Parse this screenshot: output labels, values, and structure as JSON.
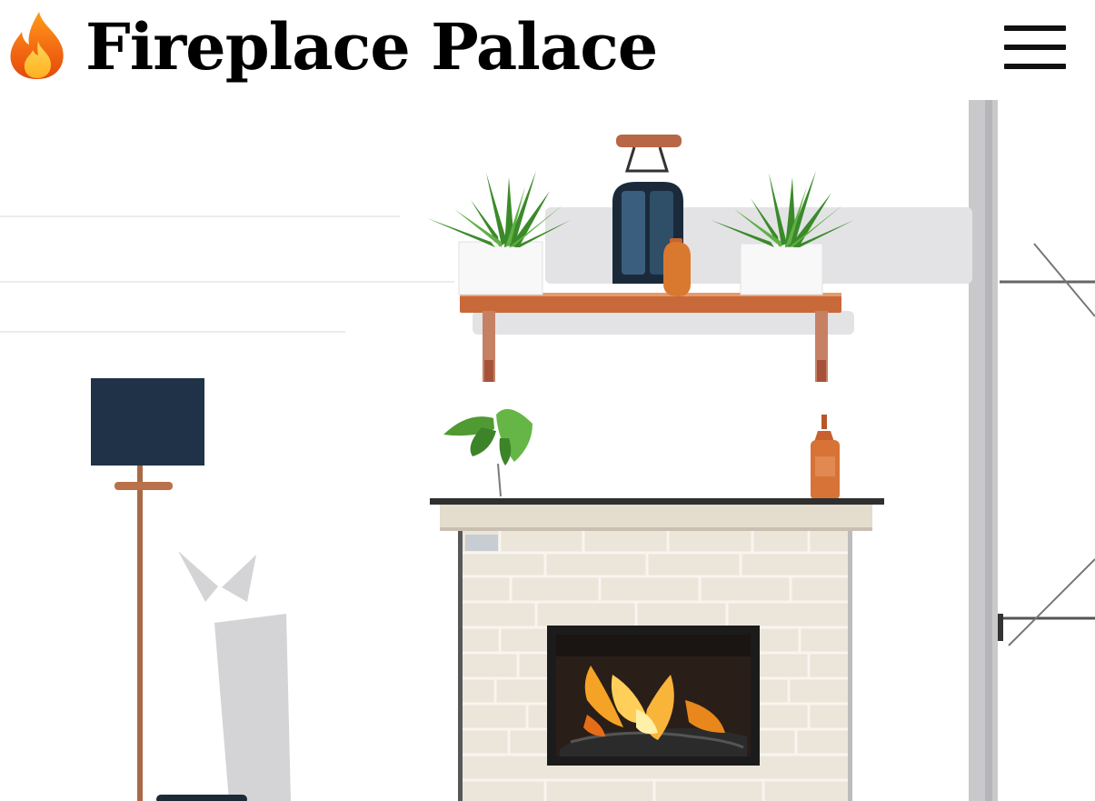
{
  "header": {
    "logo_icon": "fire-icon",
    "title": "Fireplace Palace",
    "menu_icon": "hamburger-menu-icon"
  },
  "hero": {
    "image_subject": "illustrated fireplace with mantel shelf, plants, floor lamp and window"
  },
  "colors": {
    "text": "#000000",
    "background": "#ffffff",
    "flame_orange": "#f57c00",
    "wood": "#c8693a",
    "navy": "#1e3248"
  }
}
